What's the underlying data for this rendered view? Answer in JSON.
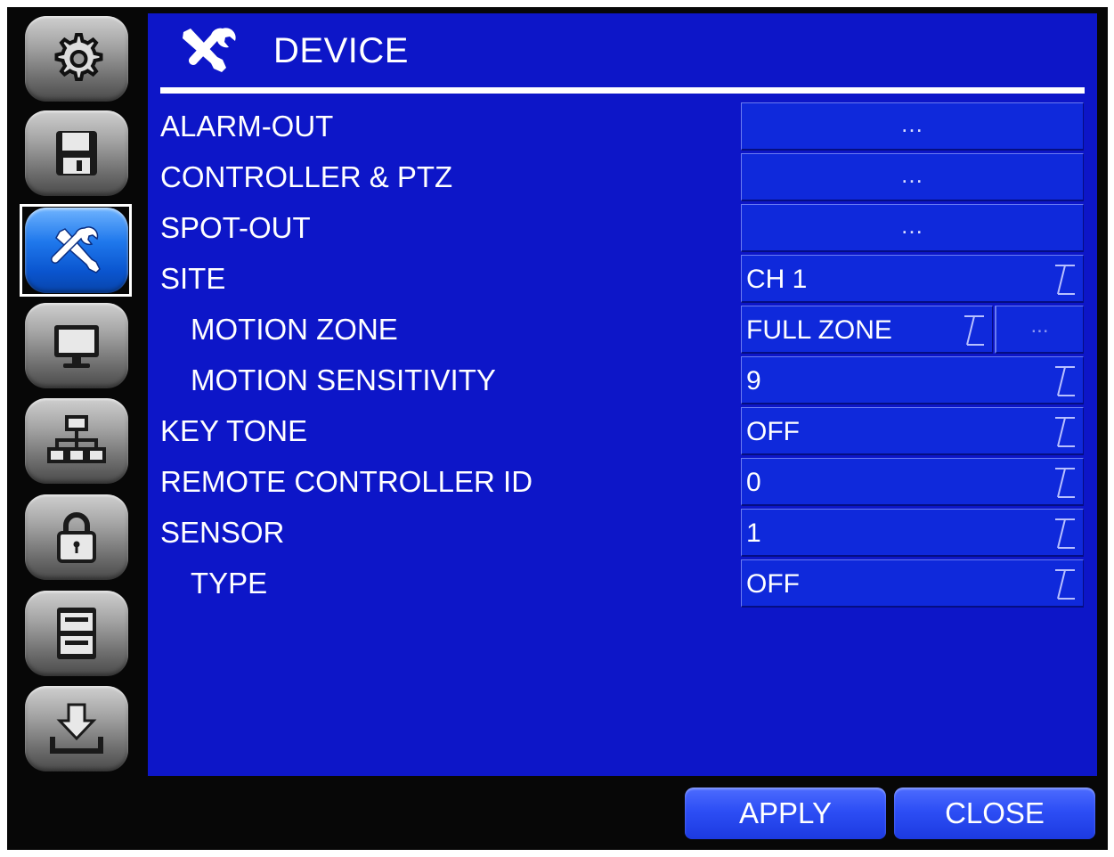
{
  "header": {
    "title": "DEVICE",
    "icon": "wrench-screwdriver-icon"
  },
  "sidebar": {
    "items": [
      {
        "name": "settings",
        "icon": "gear-icon",
        "active": false
      },
      {
        "name": "record",
        "icon": "floppy-disk-icon",
        "active": false
      },
      {
        "name": "device",
        "icon": "wrench-screwdriver-icon",
        "active": true
      },
      {
        "name": "display",
        "icon": "monitor-icon",
        "active": false
      },
      {
        "name": "network",
        "icon": "network-icon",
        "active": false
      },
      {
        "name": "security",
        "icon": "lock-icon",
        "active": false
      },
      {
        "name": "storage",
        "icon": "storage-icon",
        "active": false
      },
      {
        "name": "backup",
        "icon": "download-icon",
        "active": false
      }
    ]
  },
  "rows": [
    {
      "label": "ALARM-OUT",
      "value": "...",
      "kind": "button"
    },
    {
      "label": "CONTROLLER & PTZ",
      "value": "...",
      "kind": "button"
    },
    {
      "label": "SPOT-OUT",
      "value": "...",
      "kind": "button"
    },
    {
      "label": "SITE",
      "value": "CH 1",
      "kind": "select"
    },
    {
      "label": "MOTION ZONE",
      "value": "FULL ZONE",
      "extra": "...",
      "kind": "select-split"
    },
    {
      "label": "MOTION SENSITIVITY",
      "value": "9",
      "kind": "select"
    },
    {
      "label": "KEY TONE",
      "value": "OFF",
      "kind": "select"
    },
    {
      "label": "REMOTE CONTROLLER ID",
      "value": "0",
      "kind": "select"
    },
    {
      "label": "SENSOR",
      "value": "1",
      "kind": "select"
    },
    {
      "label": "TYPE",
      "value": "OFF",
      "kind": "select"
    }
  ],
  "buttons": {
    "apply": "APPLY",
    "close": "CLOSE"
  },
  "colors": {
    "panel": "#0d16c8",
    "field": "#0f29db",
    "button": "#2d4ef5",
    "frame": "#070707",
    "active_sidebar": "#1f78ec"
  }
}
